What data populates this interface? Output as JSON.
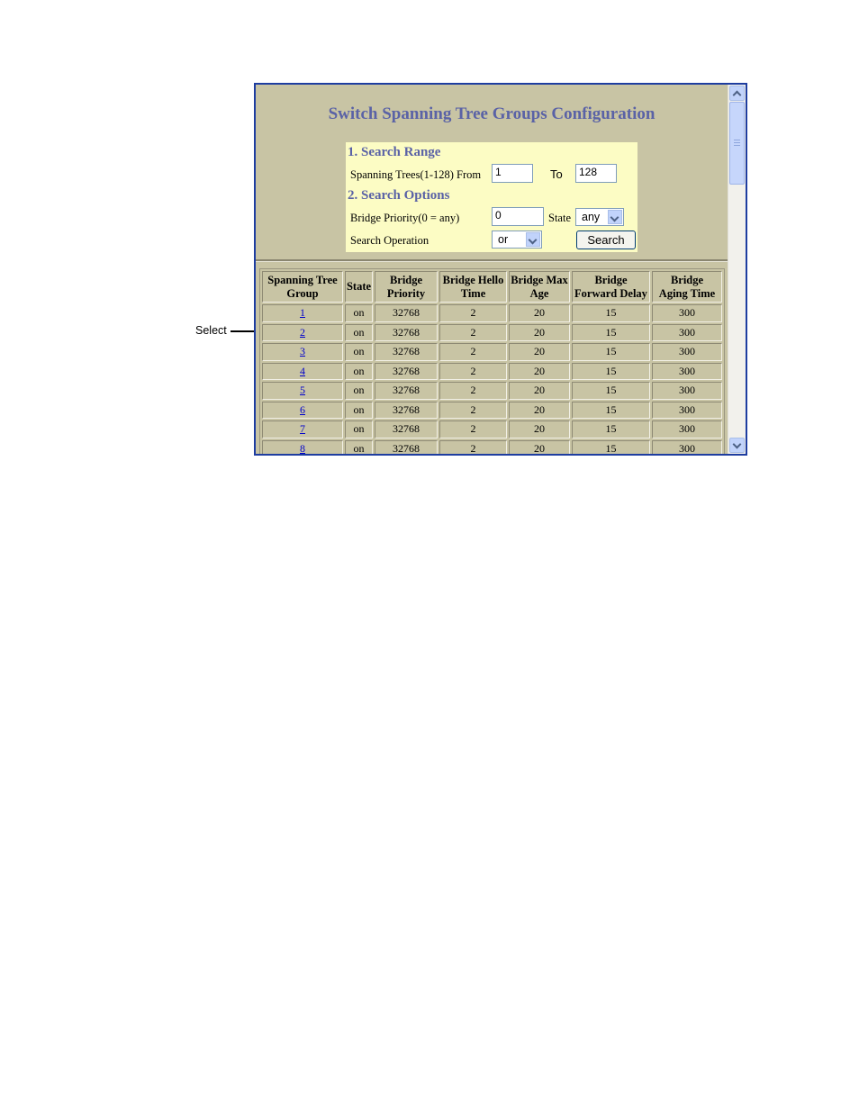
{
  "callout": {
    "label": "Select"
  },
  "page": {
    "title": "Switch Spanning Tree Groups Configuration"
  },
  "search": {
    "range_heading": "1. Search Range",
    "trees_label": "Spanning Trees(1-128) From",
    "from_value": "1",
    "to_label": "To",
    "to_value": "128",
    "options_heading": "2. Search Options",
    "priority_label": "Bridge Priority(0 = any)",
    "priority_value": "0",
    "state_label": "State",
    "state_value": "any",
    "operation_label": "Search Operation",
    "operation_value": "or",
    "search_button": "Search"
  },
  "table": {
    "headers": [
      [
        "Spanning Tree",
        "Group"
      ],
      [
        "State"
      ],
      [
        "Bridge",
        "Priority"
      ],
      [
        "Bridge Hello",
        "Time"
      ],
      [
        "Bridge Max",
        "Age"
      ],
      [
        "Bridge",
        "Forward Delay"
      ],
      [
        "Bridge",
        "Aging Time"
      ]
    ],
    "rows": [
      [
        "1",
        "on",
        "32768",
        "2",
        "20",
        "15",
        "300"
      ],
      [
        "2",
        "on",
        "32768",
        "2",
        "20",
        "15",
        "300"
      ],
      [
        "3",
        "on",
        "32768",
        "2",
        "20",
        "15",
        "300"
      ],
      [
        "4",
        "on",
        "32768",
        "2",
        "20",
        "15",
        "300"
      ],
      [
        "5",
        "on",
        "32768",
        "2",
        "20",
        "15",
        "300"
      ],
      [
        "6",
        "on",
        "32768",
        "2",
        "20",
        "15",
        "300"
      ],
      [
        "7",
        "on",
        "32768",
        "2",
        "20",
        "15",
        "300"
      ],
      [
        "8",
        "on",
        "32768",
        "2",
        "20",
        "15",
        "300"
      ]
    ]
  },
  "icons": {
    "scroll_up": "scroll-up-arrow-icon",
    "scroll_down": "scroll-down-arrow-icon",
    "dropdown": "chevron-down-icon"
  },
  "colors": {
    "panel_bg": "#c8c4a4",
    "search_bg": "#fcfcc4",
    "heading": "#5a62a6",
    "frame_border": "#1e3da0",
    "link": "#0000cc"
  }
}
